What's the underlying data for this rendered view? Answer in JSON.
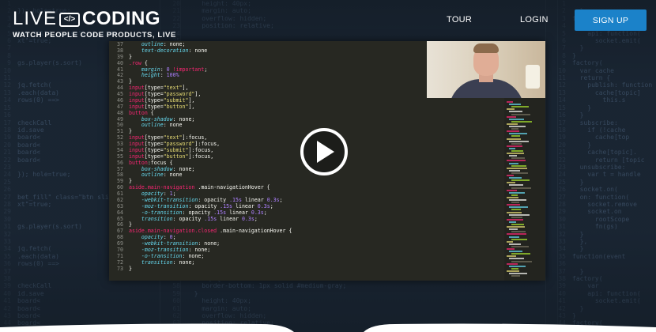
{
  "header": {
    "logo_live": "LIVE",
    "logo_badge": "</>",
    "logo_coding": "CODING",
    "logo_tagline": "WATCH PEOPLE CODE PRODUCTS, LIVE",
    "nav": [
      {
        "label": "TOUR"
      },
      {
        "label": "LOGIN"
      }
    ],
    "signup_label": "SIGN UP"
  },
  "colors": {
    "background": "#1b2735",
    "accent": "#1b82c9",
    "editor_bg": "#272822"
  },
  "video": {
    "code_lines": [
      {
        "num": "37",
        "text": "    outline: none;"
      },
      {
        "num": "38",
        "text": "    text-decoration: none"
      },
      {
        "num": "39",
        "text": "}"
      },
      {
        "num": "40",
        "text": ".row {"
      },
      {
        "num": "41",
        "text": "    margin: 0 !important;"
      },
      {
        "num": "42",
        "text": "    height: 100%"
      },
      {
        "num": "43",
        "text": "}"
      },
      {
        "num": "44",
        "text": "input[type=\"text\"],"
      },
      {
        "num": "45",
        "text": "input[type=\"password\"],"
      },
      {
        "num": "46",
        "text": "input[type=\"submit\"],"
      },
      {
        "num": "47",
        "text": "input[type=\"button\"],"
      },
      {
        "num": "48",
        "text": "button {"
      },
      {
        "num": "49",
        "text": "    box-shadow: none;"
      },
      {
        "num": "50",
        "text": "    outline: none"
      },
      {
        "num": "51",
        "text": "}"
      },
      {
        "num": "52",
        "text": "input[type=\"text\"]:focus,"
      },
      {
        "num": "53",
        "text": "input[type=\"password\"]:focus,"
      },
      {
        "num": "54",
        "text": "input[type=\"submit\"]:focus,"
      },
      {
        "num": "55",
        "text": "input[type=\"button\"]:focus,"
      },
      {
        "num": "56",
        "text": "button:focus {"
      },
      {
        "num": "57",
        "text": "    box-shadow: none;"
      },
      {
        "num": "58",
        "text": "    outline: none"
      },
      {
        "num": "59",
        "text": "}"
      },
      {
        "num": "60",
        "text": "aside.main-navigation .main-navigationHover {"
      },
      {
        "num": "61",
        "text": "    opacity: 1;"
      },
      {
        "num": "62",
        "text": "    -webkit-transition: opacity .15s linear 0.3s;"
      },
      {
        "num": "63",
        "text": "    -moz-transition: opacity .15s linear 0.3s;"
      },
      {
        "num": "64",
        "text": "    -o-transition: opacity .15s linear 0.3s;"
      },
      {
        "num": "65",
        "text": "    transition: opacity .15s linear 0.3s;"
      },
      {
        "num": "66",
        "text": "}"
      },
      {
        "num": "67",
        "text": "aside.main-navigation.closed .main-navigationHover {"
      },
      {
        "num": "68",
        "text": "    opacity: 0;"
      },
      {
        "num": "69",
        "text": "    -webkit-transition: none;"
      },
      {
        "num": "70",
        "text": "    -moz-transition: none;"
      },
      {
        "num": "71",
        "text": "    -o-transition: none;"
      },
      {
        "num": "72",
        "text": "    transition: none;"
      },
      {
        "num": "73",
        "text": "}"
      }
    ]
  }
}
